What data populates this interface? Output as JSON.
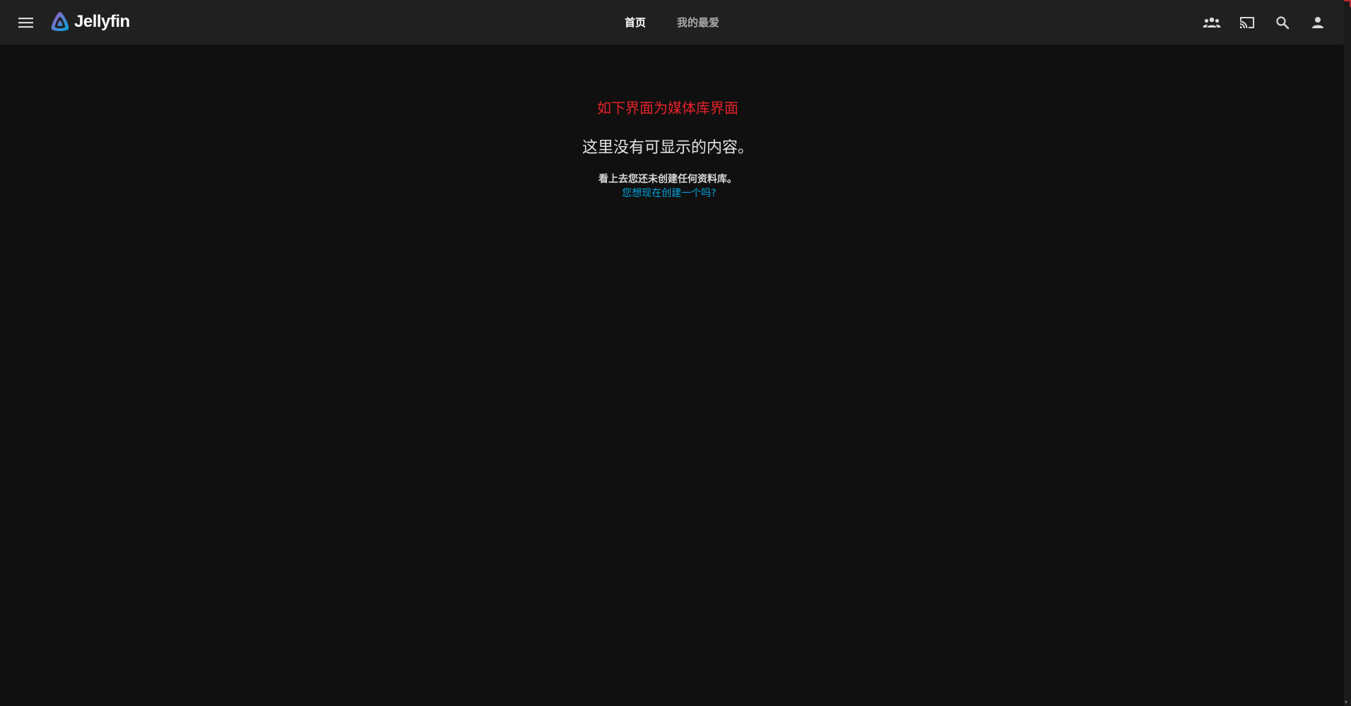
{
  "app": {
    "name": "Jellyfin"
  },
  "header": {
    "tabs": [
      {
        "label": "首页",
        "active": true
      },
      {
        "label": "我的最爱",
        "active": false
      }
    ],
    "icons": [
      "menu-icon",
      "group-icon",
      "cast-icon",
      "search-icon",
      "user-icon"
    ]
  },
  "main": {
    "annotation": "如下界面为媒体库界面",
    "empty_title": "这里没有可显示的内容。",
    "empty_description": "看上去您还未创建任何资料库。",
    "create_link": "您想现在创建一个吗?"
  },
  "colors": {
    "background": "#101010",
    "header": "#202020",
    "annotation": "#e8222a",
    "link": "#00a4dc"
  }
}
